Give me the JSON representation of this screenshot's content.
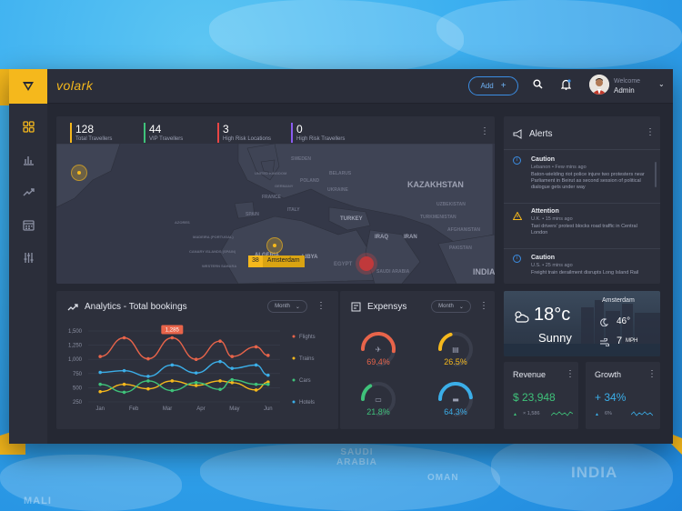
{
  "header": {
    "brand": "volark",
    "add_label": "Add",
    "welcome": "Welcome",
    "user": "Admin"
  },
  "sidebar": {
    "items": [
      {
        "icon": "grid-icon",
        "active": true
      },
      {
        "icon": "bar-chart-icon",
        "active": false
      },
      {
        "icon": "trend-icon",
        "active": false
      },
      {
        "icon": "calendar-icon",
        "active": false
      },
      {
        "icon": "sliders-icon",
        "active": false
      }
    ]
  },
  "stats": [
    {
      "value": "128",
      "label": "Total Travellers",
      "color": "#f5b81c"
    },
    {
      "value": "44",
      "label": "VIP Travellers",
      "color": "#3fc27a"
    },
    {
      "value": "3",
      "label": "High Risk Locations",
      "color": "#e84545"
    },
    {
      "value": "0",
      "label": "High Risk Travellers",
      "color": "#8a5cf0"
    }
  ],
  "map": {
    "labels": {
      "kazakhstan": "KAZAKHSTAN",
      "turkey": "TURKEY",
      "iraq": "IRAQ",
      "iran": "IRAN",
      "algeria": "ALGERIA",
      "libya": "LIBYA",
      "egypt": "EGYPT",
      "india": "INDIA",
      "spain": "SPAIN",
      "poland": "POLAND",
      "ukraine": "UKRAINE",
      "sweden": "SWEDEN",
      "united_kingdom": "UNITED KINGDOM",
      "belarus": "BELARUS",
      "france": "FRANCE",
      "italy": "ITALY",
      "germany": "GERMANY",
      "saudi_arabia": "SAUDI ARABIA",
      "uzbekistan": "UZBEKISTAN",
      "turkmenistan": "TURKMENISTAN",
      "afghanistan": "AFGHANISTAN",
      "pakistan": "PAKISTAN",
      "azores": "AZORES",
      "madeira": "MADEIRA (PORTUGAL)",
      "canary": "CANARY ISLANDS (SPAIN)",
      "western_sahara": "WESTERN SAHARA"
    },
    "tag_count": "38",
    "tag_city": "Amsterdam"
  },
  "alerts": {
    "title": "Alerts",
    "items": [
      {
        "type": "Caution",
        "place": "Lebanon",
        "time": "Few mins ago",
        "text": "Baton-wielding riot police injure two protesters near Parliament in Beirut as second session of political dialogue gets under way",
        "color": "#3b8de3"
      },
      {
        "type": "Attention",
        "place": "U.K.",
        "time": "15 mins ago",
        "text": "Taxi drivers' protest blocks road traffic in Central London",
        "color": "#f5b81c"
      },
      {
        "type": "Caution",
        "place": "U.S.",
        "time": "25 mins ago",
        "text": "Freight train derailment disrupts Long Island Rail",
        "color": "#3b8de3"
      }
    ]
  },
  "analytics": {
    "title": "Analytics - Total bookings",
    "filter": "Month",
    "tooltip": "1,285"
  },
  "chart_data": {
    "type": "line",
    "title": "Analytics - Total bookings",
    "x": [
      "Jan",
      "Feb",
      "Mar",
      "Apr",
      "May",
      "Jun"
    ],
    "yticks": [
      250,
      500,
      750,
      1000,
      1250,
      1500
    ],
    "ytick_labels": [
      "250",
      "500",
      "750",
      "1,000",
      "1,250",
      "1,500"
    ],
    "ylim": [
      250,
      1500
    ],
    "series": [
      {
        "name": "Flights",
        "color": "#e8644a",
        "points": [
          [
            0.5,
            1050
          ],
          [
            1.5,
            1380
          ],
          [
            2.5,
            1010
          ],
          [
            3.5,
            1380
          ],
          [
            4.5,
            1000
          ],
          [
            5.5,
            1320
          ],
          [
            6,
            1050
          ],
          [
            7,
            1220
          ],
          [
            7.5,
            1070
          ]
        ]
      },
      {
        "name": "Trains",
        "color": "#f5b81c",
        "points": [
          [
            0.5,
            430
          ],
          [
            1.5,
            560
          ],
          [
            2.5,
            480
          ],
          [
            3.5,
            620
          ],
          [
            4.5,
            540
          ],
          [
            5.5,
            620
          ],
          [
            6,
            590
          ],
          [
            7,
            460
          ],
          [
            7.5,
            600
          ]
        ]
      },
      {
        "name": "Cars",
        "color": "#3fc27a",
        "points": [
          [
            0.5,
            560
          ],
          [
            1.5,
            420
          ],
          [
            2.5,
            620
          ],
          [
            3.5,
            450
          ],
          [
            4.5,
            590
          ],
          [
            5.5,
            470
          ],
          [
            6,
            640
          ],
          [
            7,
            560
          ],
          [
            7.5,
            560
          ]
        ]
      },
      {
        "name": "Hotels",
        "color": "#3baee8",
        "points": [
          [
            0.5,
            770
          ],
          [
            1.5,
            800
          ],
          [
            2.5,
            700
          ],
          [
            3.5,
            900
          ],
          [
            4.5,
            760
          ],
          [
            5.5,
            960
          ],
          [
            6,
            840
          ],
          [
            7,
            900
          ],
          [
            7.5,
            720
          ]
        ]
      }
    ],
    "legend": "right",
    "grid": true
  },
  "expenses": {
    "title": "Expensys",
    "filter": "Month",
    "items": [
      {
        "icon": "plane-icon",
        "value": "69.4%",
        "color": "#e8644a",
        "fraction": 0.694
      },
      {
        "icon": "train-icon",
        "value": "26.5%",
        "color": "#f5b81c",
        "fraction": 0.265
      },
      {
        "icon": "car-icon",
        "value": "21.8%",
        "color": "#3fc27a",
        "fraction": 0.218
      },
      {
        "icon": "bed-icon",
        "value": "64.3%",
        "color": "#3baee8",
        "fraction": 0.643
      }
    ]
  },
  "weather": {
    "city": "Amsterdam",
    "temp": "18°c",
    "condition": "Sunny",
    "humidity": "46°",
    "wind_value": "7",
    "wind_unit": "MPH"
  },
  "revenue": {
    "title": "Revenue",
    "value": "$ 23,948",
    "change": "× 1,586",
    "color": "#3fc27a"
  },
  "growth": {
    "title": "Growth",
    "value": "+ 34%",
    "change": "6%",
    "color": "#3baee8"
  },
  "background": {
    "labels": {
      "saudi_arabia": "SAUDI\nARABIA",
      "oman": "OMAN",
      "india": "INDIA",
      "mali": "MALI"
    }
  }
}
